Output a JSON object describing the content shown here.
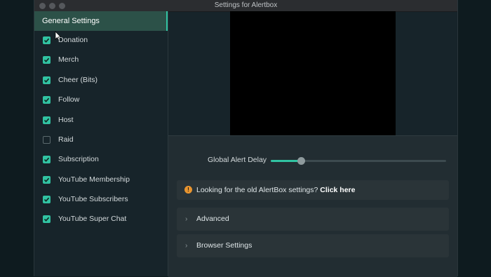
{
  "window": {
    "title": "Settings for Alertbox"
  },
  "sidebar": {
    "header": "General Settings",
    "items": [
      {
        "label": "Donation",
        "checked": true
      },
      {
        "label": "Merch",
        "checked": true
      },
      {
        "label": "Cheer (Bits)",
        "checked": true
      },
      {
        "label": "Follow",
        "checked": true
      },
      {
        "label": "Host",
        "checked": true
      },
      {
        "label": "Raid",
        "checked": false
      },
      {
        "label": "Subscription",
        "checked": true
      },
      {
        "label": "YouTube Membership",
        "checked": true
      },
      {
        "label": "YouTube Subscribers",
        "checked": true
      },
      {
        "label": "YouTube Super Chat",
        "checked": true
      }
    ]
  },
  "settings": {
    "delay_label": "Global Alert Delay",
    "delay_level": 0.17,
    "notice_text": "Looking for the old AlertBox settings?",
    "notice_link": "Click here",
    "advanced_label": "Advanced",
    "browser_label": "Browser Settings"
  },
  "colors": {
    "accent": "#31c3a2",
    "warning": "#e9952f",
    "preview_bg": "#000000"
  },
  "icons": {
    "notice": "info-icon",
    "accordion": "chevron-right-icon",
    "checkbox": "check-icon"
  }
}
